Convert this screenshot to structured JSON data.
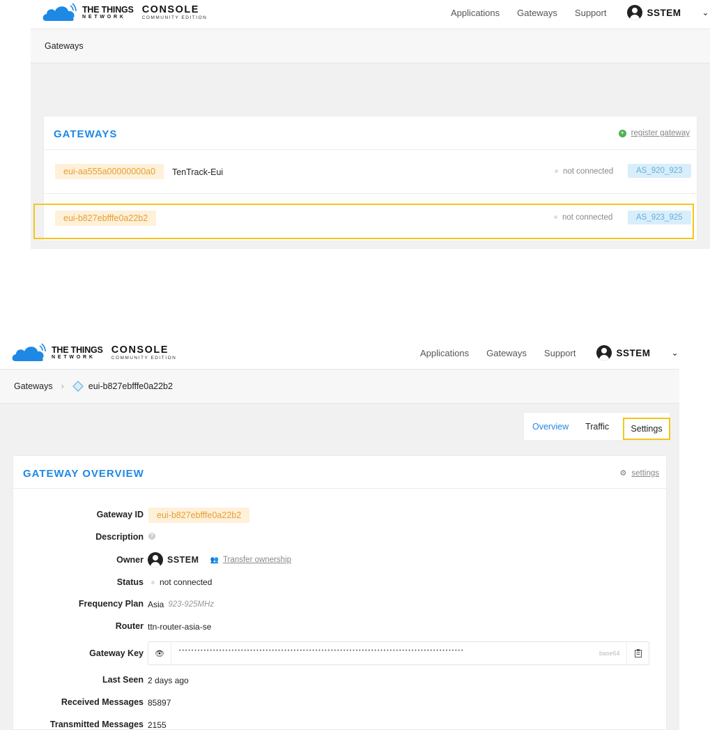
{
  "brand": {
    "ttn_line1": "THE THINGS",
    "ttn_line2": "NETWORK",
    "console_line1": "CONSOLE",
    "console_line2": "COMMUNITY EDITION",
    "cloud_icon": "cloud-icon",
    "color": "#1e88e5"
  },
  "nav": {
    "applications": "Applications",
    "gateways": "Gateways",
    "support": "Support",
    "user": "SSTEM",
    "user_icon": "user-avatar-icon",
    "chevron": "⌄"
  },
  "top": {
    "breadcrumb": "Gateways",
    "card_title": "GATEWAYS",
    "register_label": "register gateway",
    "rows": [
      {
        "eui": "eui-aa555a00000000a0",
        "name": "TenTrack-Eui",
        "status": "not connected",
        "band": "AS_920_923"
      },
      {
        "eui": "eui-b827ebfffe0a22b2",
        "name": "",
        "status": "not connected",
        "band": "AS_923_925"
      }
    ]
  },
  "bottom": {
    "breadcrumb_root": "Gateways",
    "breadcrumb_sep": "›",
    "breadcrumb_current": "eui-b827ebfffe0a22b2",
    "tabs": {
      "overview": "Overview",
      "traffic": "Traffic",
      "settings": "Settings"
    },
    "card_title": "GATEWAY OVERVIEW",
    "settings_link": "settings",
    "fields": {
      "gateway_id_label": "Gateway ID",
      "gateway_id": "eui-b827ebfffe0a22b2",
      "description_label": "Description",
      "owner_label": "Owner",
      "owner": "SSTEM",
      "transfer_label": "Transfer ownership",
      "status_label": "Status",
      "status": "not connected",
      "freq_label": "Frequency Plan",
      "freq_region": "Asia",
      "freq_range": "923-925MHz",
      "router_label": "Router",
      "router": "ttn-router-asia-se",
      "key_label": "Gateway Key",
      "key_dots": "••••••••••••••••••••••••••••••••••••••••••••••••••••••••••••••••••••••••••••••••••••••••••••",
      "key_encoding": "base64",
      "last_seen_label": "Last Seen",
      "last_seen": "2 days ago",
      "received_label": "Received Messages",
      "received": "85897",
      "transmitted_label": "Transmitted Messages",
      "transmitted": "2155"
    }
  },
  "colors": {
    "accent": "#1e88e5",
    "eui_bg": "#fff0d9",
    "eui_text": "#e3a133",
    "band_bg": "#d8eefb",
    "band_text": "#6aaed6",
    "highlight": "#f5c518",
    "register_green": "#4caf50"
  }
}
